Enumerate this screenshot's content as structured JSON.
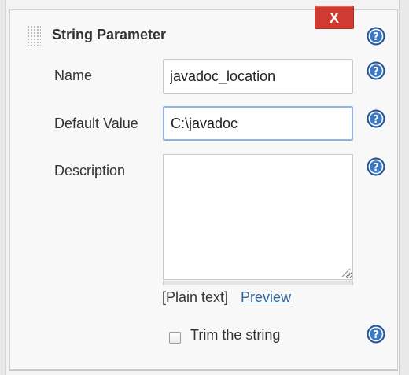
{
  "panel": {
    "title": "String Parameter",
    "delete_label": "X"
  },
  "fields": {
    "name": {
      "label": "Name",
      "value": "javadoc_location"
    },
    "default_value": {
      "label": "Default Value",
      "value": "C:\\javadoc"
    },
    "description": {
      "label": "Description",
      "value": ""
    }
  },
  "description_footer": {
    "plain_text": "[Plain text]",
    "preview_link": "Preview"
  },
  "trim": {
    "label": "Trim the string",
    "checked": false
  },
  "colors": {
    "delete_button": "#cf3b30",
    "help_icon": "#2e64a8",
    "link": "#336699",
    "focus_border": "#8fb3e4"
  },
  "icons": {
    "help": "question-mark-circle-icon",
    "drag": "drag-handle-icon"
  }
}
